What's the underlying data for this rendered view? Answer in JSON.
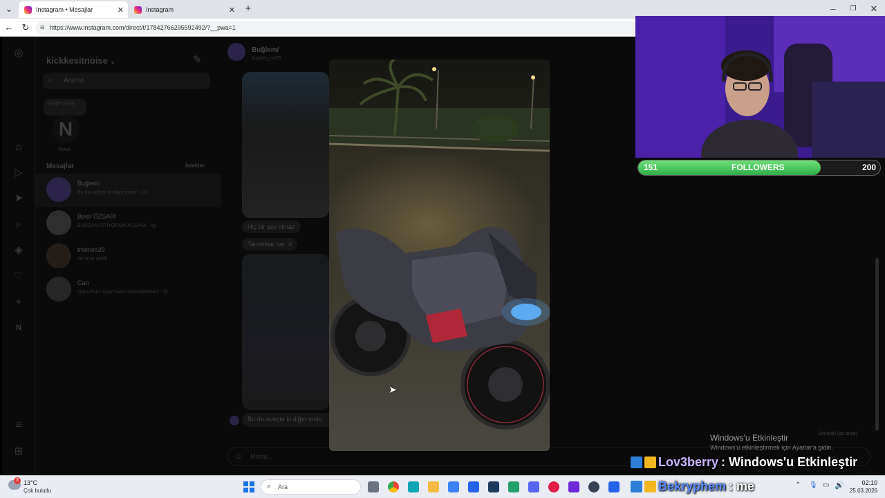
{
  "browser": {
    "tabs": [
      {
        "title": "Instagram • Mesajlar",
        "active": true
      },
      {
        "title": "Instagram",
        "active": false
      }
    ],
    "url": "https://www.instagram.com/direct/t/17842766295592492/?__pwa=1"
  },
  "inbox": {
    "username": "kickkesitnoise",
    "search_placeholder": "Arama",
    "note_bubble": "İçeriğini paylaş",
    "note_initial": "N",
    "note_label": "Notun",
    "messages_heading": "Mesajlar",
    "requests_link": "İstekler",
    "conversations": [
      {
        "name": "Buğlem/",
        "preview": "Bu da isveçte ki diğer motor · 1d"
      },
      {
        "name": "Bekir ÖZSARI",
        "preview": "BUNDAN İSTİYORUM ALSANA · 4g"
      },
      {
        "name": "trkenes39",
        "preview": "4d önce aktifti"
      },
      {
        "name": "Can",
        "preview": "https://vdo.ninja/?view=Makewhethert · 1h"
      }
    ]
  },
  "chat": {
    "contact_name": "Buğlem/",
    "contact_handle": "buglem_mt09",
    "messages": [
      "Hiç bir şey olmaz",
      "Tanıdıklar var .d",
      "Bu da isveçte ki diğer moto"
    ],
    "composer_placeholder": "Mesaj..."
  },
  "overlay": {
    "followers_current": "151",
    "followers_label": "FOLLOWERS",
    "followers_goal": "200",
    "followers_progress": 0.755,
    "chat": [
      {
        "user": "Lov3berry",
        "text": ": Windows'u Etkinleştir",
        "color": "#c9b6ff"
      },
      {
        "user": "Bekryphem",
        "text": ": me",
        "color": "#5b8cff"
      }
    ]
  },
  "activation": {
    "title": "Windows'u Etkinleştir",
    "subtitle": "Windows'u etkinleştirmek için Ayarlar'a gidin.",
    "seen": "Görüldü (az önce)"
  },
  "taskbar": {
    "weather_badge": "3",
    "temperature": "13°C",
    "condition": "Çok bulutlu",
    "search": "Ara",
    "time": "02:10",
    "date": "25.03.2026"
  },
  "colors": {
    "instagram_bg": "#0a0a0a",
    "followers_fill": "#3fbf55",
    "taskbar": "#e9ecf3"
  }
}
